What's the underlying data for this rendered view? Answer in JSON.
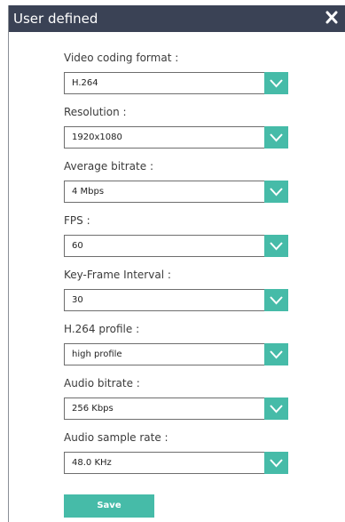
{
  "dialog": {
    "title": "User defined",
    "close_icon": "close-icon"
  },
  "fields": [
    {
      "label": "Video coding format :",
      "value": "H.264"
    },
    {
      "label": "Resolution :",
      "value": "1920x1080"
    },
    {
      "label": "Average bitrate :",
      "value": "4 Mbps"
    },
    {
      "label": "FPS :",
      "value": "60"
    },
    {
      "label": "Key-Frame Interval :",
      "value": "30"
    },
    {
      "label": "H.264 profile :",
      "value": "high profile"
    },
    {
      "label": "Audio bitrate :",
      "value": "256 Kbps"
    },
    {
      "label": "Audio sample rate :",
      "value": "48.0 KHz"
    }
  ],
  "save_label": "Save",
  "colors": {
    "titlebar": "#3a4255",
    "accent": "#46bba8"
  },
  "icons": {
    "dropdown": "chevron-down-icon"
  }
}
